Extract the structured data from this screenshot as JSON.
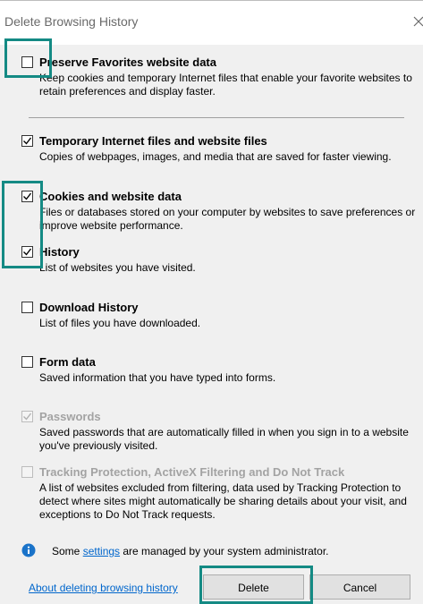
{
  "window": {
    "title": "Delete Browsing History",
    "close_icon": "close-icon"
  },
  "options": [
    {
      "label": "Preserve Favorites website data",
      "description": "Keep cookies and temporary Internet files that enable your favorite websites to retain preferences and display faster.",
      "checked": false,
      "enabled": true
    },
    {
      "label": "Temporary Internet files and website files",
      "description": "Copies of webpages, images, and media that are saved for faster viewing.",
      "checked": true,
      "enabled": true
    },
    {
      "label": "Cookies and website data",
      "description": "Files or databases stored on your computer by websites to save preferences or improve website performance.",
      "checked": true,
      "enabled": true
    },
    {
      "label": "History",
      "description": "List of websites you have visited.",
      "checked": true,
      "enabled": true
    },
    {
      "label": "Download History",
      "description": "List of files you have downloaded.",
      "checked": false,
      "enabled": true
    },
    {
      "label": "Form data",
      "description": "Saved information that you have typed into forms.",
      "checked": false,
      "enabled": true
    },
    {
      "label": "Passwords",
      "description": "Saved passwords that are automatically filled in when you sign in to a website you've previously visited.",
      "checked": true,
      "enabled": false
    },
    {
      "label": "Tracking Protection, ActiveX Filtering and Do Not Track",
      "description": "A list of websites excluded from filtering, data used by Tracking Protection to detect where sites might automatically be sharing details about your visit, and exceptions to Do Not Track requests.",
      "checked": false,
      "enabled": false
    }
  ],
  "info": {
    "icon": "info-icon",
    "prefix": "Some ",
    "link": "settings",
    "suffix": " are managed by your system administrator."
  },
  "footer": {
    "about_link": "About deleting browsing history",
    "delete_label": "Delete",
    "cancel_label": "Cancel"
  },
  "colors": {
    "highlight": "#148a84",
    "link": "#0066cc",
    "info_icon": "#1a73c9"
  }
}
